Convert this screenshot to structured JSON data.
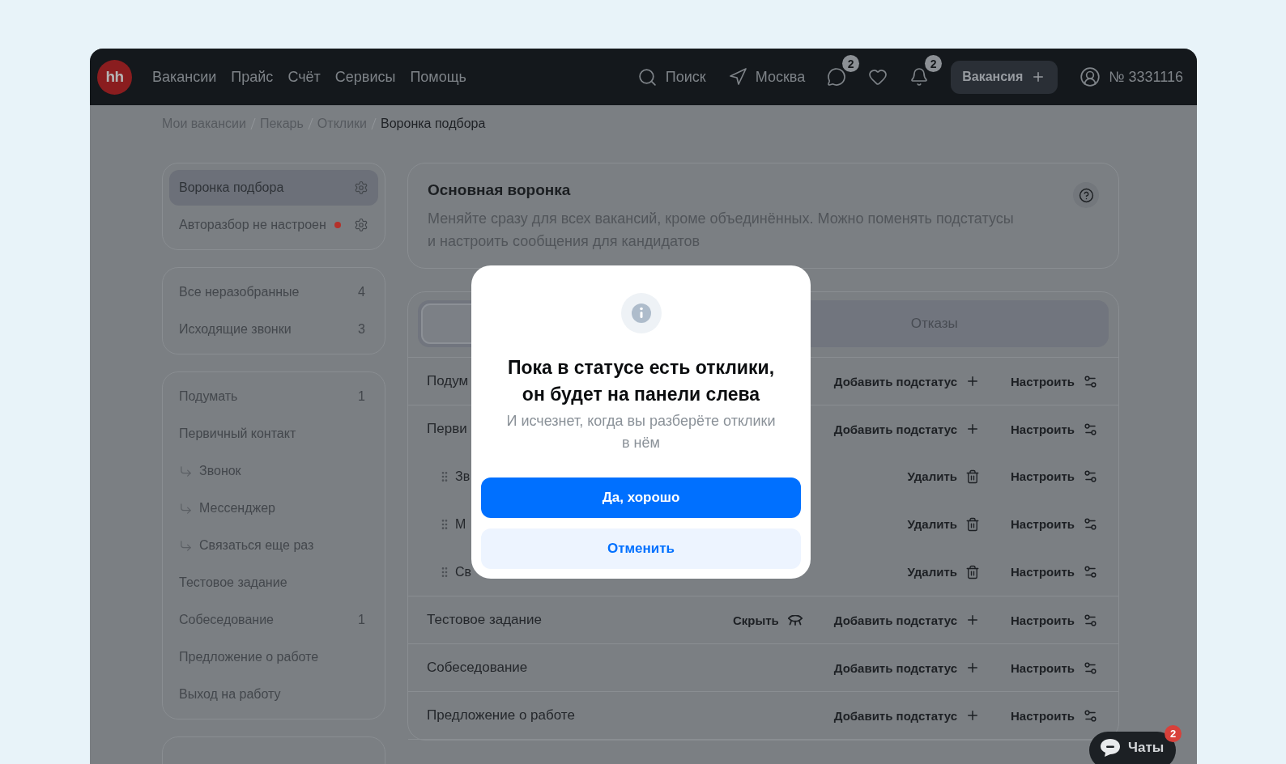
{
  "header": {
    "logo": "hh",
    "nav": [
      "Вакансии",
      "Прайс",
      "Счёт",
      "Сервисы",
      "Помощь"
    ],
    "search": "Поиск",
    "location": "Москва",
    "icons": [
      {
        "kind": "chat",
        "badge": "2"
      },
      {
        "kind": "favorites"
      },
      {
        "kind": "notifications",
        "badge": "2"
      }
    ],
    "create_button": "Вакансия",
    "account": "№ 3331116"
  },
  "breadcrumb": [
    {
      "label": "Мои вакансии",
      "current": false
    },
    {
      "label": "Пекарь",
      "current": false
    },
    {
      "label": "Отклики",
      "current": false
    },
    {
      "label": "Воронка подбора",
      "current": true
    }
  ],
  "sidebar": {
    "groups": [
      {
        "items": [
          {
            "kind": "settings",
            "label": "Воронка подбора",
            "selected": true,
            "alert": false
          },
          {
            "kind": "settings",
            "label": "Авторазбор не настроен",
            "selected": false,
            "alert": true
          }
        ]
      },
      {
        "items": [
          {
            "label": "Все неразобранные",
            "count": "4",
            "selected": false
          },
          {
            "label": "Исходящие звонки",
            "count": "3",
            "selected": false
          }
        ]
      },
      {
        "items": [
          {
            "label": "Подумать",
            "count": "1",
            "selected": false
          },
          {
            "label": "Первичный контакт",
            "selected": false,
            "children": [
              {
                "label": "Звонок",
                "selected": false
              },
              {
                "label": "Мессенджер",
                "selected": false
              },
              {
                "label": "Связаться еще раз",
                "selected": false
              }
            ]
          },
          {
            "label": "Тестовое задание",
            "selected": false
          },
          {
            "label": "Собеседование",
            "count": "1",
            "selected": false
          },
          {
            "label": "Предложение о работе",
            "selected": false
          },
          {
            "label": "Выход на работу",
            "selected": false
          }
        ]
      }
    ]
  },
  "funnel_info": {
    "title": "Основная воронка",
    "description": "Меняйте сразу для всех вакансий, кроме объединённых. Можно поменять подстатусы и настроить сообщения для кандидатов"
  },
  "funnel": {
    "tabs": [
      {
        "selected": true
      },
      {
        "label": "Отказы",
        "selected": false
      }
    ],
    "stages": [
      {
        "label": "Подум",
        "actions": [
          {
            "kind": "add",
            "label": "Добавить подстатус"
          },
          {
            "kind": "configure",
            "label": "Настроить"
          }
        ]
      },
      {
        "label": "Перви",
        "actions": [
          {
            "kind": "add",
            "label": "Добавить подстатус"
          },
          {
            "kind": "configure",
            "label": "Настроить"
          }
        ],
        "children": [
          {
            "label": "Зв",
            "actions": [
              {
                "kind": "delete",
                "label": "Удалить"
              },
              {
                "kind": "configure",
                "label": "Настроить"
              }
            ]
          },
          {
            "label": "М",
            "actions": [
              {
                "kind": "delete",
                "label": "Удалить"
              },
              {
                "kind": "configure",
                "label": "Настроить"
              }
            ]
          },
          {
            "label": "Св",
            "actions": [
              {
                "kind": "delete",
                "label": "Удалить"
              },
              {
                "kind": "configure",
                "label": "Настроить"
              }
            ]
          }
        ]
      },
      {
        "label": "Тестовое задание",
        "actions": [
          {
            "kind": "hide",
            "label": "Скрыть"
          },
          {
            "kind": "add",
            "label": "Добавить подстатус"
          },
          {
            "kind": "configure",
            "label": "Настроить"
          }
        ]
      },
      {
        "label": "Собеседование",
        "actions": [
          {
            "kind": "add",
            "label": "Добавить подстатус"
          },
          {
            "kind": "configure",
            "label": "Настроить"
          }
        ]
      },
      {
        "label": "Предложение о работе",
        "actions": [
          {
            "kind": "add",
            "label": "Добавить подстатус"
          },
          {
            "kind": "configure",
            "label": "Настроить"
          }
        ]
      }
    ]
  },
  "dialog": {
    "title": "Пока в статусе есть отклики, он будет на панели слева",
    "text": "И исчезнет, когда вы разберёте отклики в нём",
    "buttons": [
      {
        "kind": "primary",
        "label": "Да, хорошо"
      },
      {
        "kind": "secondary",
        "label": "Отменить"
      }
    ]
  },
  "chat_widget": {
    "label": "Чаты",
    "badge": "2"
  }
}
